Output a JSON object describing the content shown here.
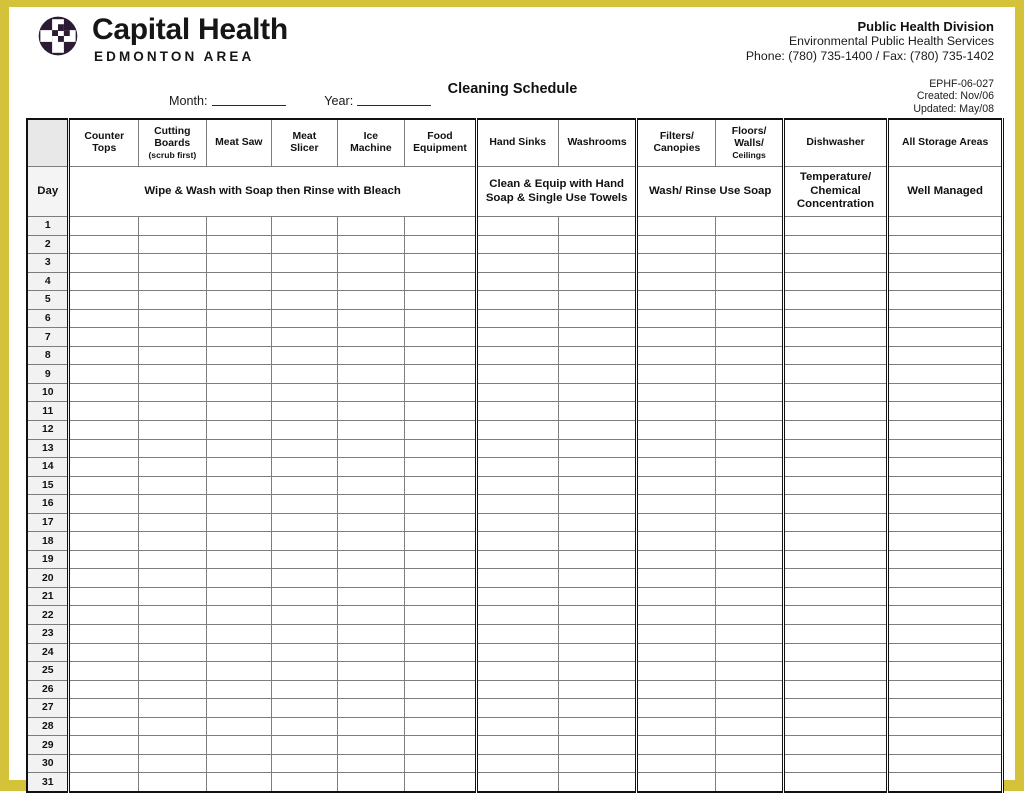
{
  "frame": {
    "border_color": "#d4c33a"
  },
  "brand": {
    "logo_icon": "capital-health-circle-logo",
    "name": "Capital Health",
    "region": "EDMONTON AREA"
  },
  "org": {
    "division": "Public Health Division",
    "services": "Environmental Public Health Services",
    "contact": "Phone: (780) 735-1400 / Fax: (780) 735-1402"
  },
  "document": {
    "title": "Cleaning Schedule",
    "form_number": "EPHF-06-027",
    "created": "Created: Nov/06",
    "updated": "Updated: May/08",
    "month_label": "Month:",
    "year_label": "Year:",
    "month_value": "",
    "year_value": "",
    "watermark": ""
  },
  "table": {
    "day_header": "Day",
    "corner_blank": "",
    "columns": [
      {
        "id": "counter-tops",
        "label": "Counter Tops",
        "line1": "Counter",
        "line2": "Tops",
        "note": "",
        "group": 1
      },
      {
        "id": "cutting-boards",
        "label": "Cutting Boards",
        "line1": "Cutting",
        "line2": "Boards",
        "note": "(scrub first)",
        "group": 1
      },
      {
        "id": "meat-saw",
        "label": "Meat Saw",
        "line1": "Meat Saw",
        "line2": "",
        "note": "",
        "group": 1
      },
      {
        "id": "meat-slicer",
        "label": "Meat Slicer",
        "line1": "Meat",
        "line2": "Slicer",
        "note": "",
        "group": 1
      },
      {
        "id": "ice-machine",
        "label": "Ice Machine",
        "line1": "Ice",
        "line2": "Machine",
        "note": "",
        "group": 1
      },
      {
        "id": "food-equipment",
        "label": "Food Equipment",
        "line1": "Food",
        "line2": "Equipment",
        "note": "",
        "group": 1
      },
      {
        "id": "hand-sinks",
        "label": "Hand Sinks",
        "line1": "Hand Sinks",
        "line2": "",
        "note": "",
        "group": 2
      },
      {
        "id": "washrooms",
        "label": "Washrooms",
        "line1": "Washrooms",
        "line2": "",
        "note": "",
        "group": 2
      },
      {
        "id": "filters-canopies",
        "label": "Filters/ Canopies",
        "line1": "Filters/",
        "line2": "Canopies",
        "note": "",
        "group": 3
      },
      {
        "id": "floors-walls-ceilings",
        "label": "Floors/ Walls/ Ceilings",
        "line1": "Floors/",
        "line2": "Walls/",
        "note": "Ceilings",
        "group": 3
      },
      {
        "id": "dishwasher",
        "label": "Dishwasher",
        "line1": "Dishwasher",
        "line2": "",
        "note": "",
        "group": 4
      },
      {
        "id": "all-storage-areas",
        "label": "All Storage Areas",
        "line1": "All Storage Areas",
        "line2": "",
        "note": "",
        "group": 5
      }
    ],
    "instruction_groups": [
      {
        "id": "group-wipe-wash",
        "text": "Wipe & Wash with Soap then Rinse with Bleach",
        "span": 6
      },
      {
        "id": "group-hand-soap",
        "text": "Clean & Equip with Hand Soap & Single Use Towels",
        "span": 2
      },
      {
        "id": "group-wash-rinse",
        "text": "Wash/ Rinse Use Soap",
        "span": 2
      },
      {
        "id": "group-temperature",
        "text": "Temperature/ Chemical Concentration",
        "span": 1
      },
      {
        "id": "group-well-managed",
        "text": "Well Managed",
        "span": 1
      }
    ],
    "days": [
      "1",
      "2",
      "3",
      "4",
      "5",
      "6",
      "7",
      "8",
      "9",
      "10",
      "11",
      "12",
      "13",
      "14",
      "15",
      "16",
      "17",
      "18",
      "19",
      "20",
      "21",
      "22",
      "23",
      "24",
      "25",
      "26",
      "27",
      "28",
      "29",
      "30",
      "31"
    ]
  }
}
